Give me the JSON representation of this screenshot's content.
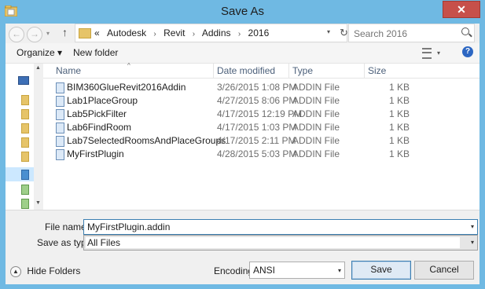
{
  "window": {
    "title": "Save As",
    "close_glyph": "✕"
  },
  "nav": {
    "back_glyph": "←",
    "forward_glyph": "→",
    "up_glyph": "↑",
    "dropdown_glyph": "▾",
    "refresh_glyph": "↻"
  },
  "address": {
    "overflow": "«",
    "crumbs": [
      "Autodesk",
      "Revit",
      "Addins",
      "2016"
    ],
    "separator": "›"
  },
  "search": {
    "placeholder": "Search 2016"
  },
  "toolbar": {
    "organize_label": "Organize ▾",
    "new_folder_label": "New folder",
    "help_glyph": "?"
  },
  "columns": {
    "name": "Name",
    "date": "Date modified",
    "type": "Type",
    "size": "Size",
    "sort_glyph": "^"
  },
  "files": [
    {
      "name": "BIM360GlueRevit2016Addin",
      "date": "3/26/2015 1:08 PM",
      "type": "ADDIN File",
      "size": "1 KB"
    },
    {
      "name": "Lab1PlaceGroup",
      "date": "4/27/2015 8:06 PM",
      "type": "ADDIN File",
      "size": "1 KB"
    },
    {
      "name": "Lab5PickFilter",
      "date": "4/17/2015 12:19 PM",
      "type": "ADDIN File",
      "size": "1 KB"
    },
    {
      "name": "Lab6FindRoom",
      "date": "4/17/2015 1:03 PM",
      "type": "ADDIN File",
      "size": "1 KB"
    },
    {
      "name": "Lab7SelectedRoomsAndPlaceGroups",
      "date": "4/17/2015 2:11 PM",
      "type": "ADDIN File",
      "size": "1 KB"
    },
    {
      "name": "MyFirstPlugin",
      "date": "4/28/2015 5:03 PM",
      "type": "ADDIN File",
      "size": "1 KB"
    }
  ],
  "form": {
    "file_name_label": "File name:",
    "file_name_value": "MyFirstPlugin.addin",
    "save_type_label": "Save as type:",
    "save_type_value": "All Files"
  },
  "footer": {
    "hide_folders_label": "Hide Folders",
    "hide_glyph": "▲",
    "encoding_label": "Encoding:",
    "encoding_value": "ANSI",
    "save_label": "Save",
    "cancel_label": "Cancel"
  },
  "scroll": {
    "up_glyph": "▲",
    "down_glyph": "▼"
  },
  "colors": {
    "titlebar": "#6fb9e3",
    "close": "#c7504a",
    "selection": "#cce8ff",
    "accent": "#3c7fb1"
  }
}
